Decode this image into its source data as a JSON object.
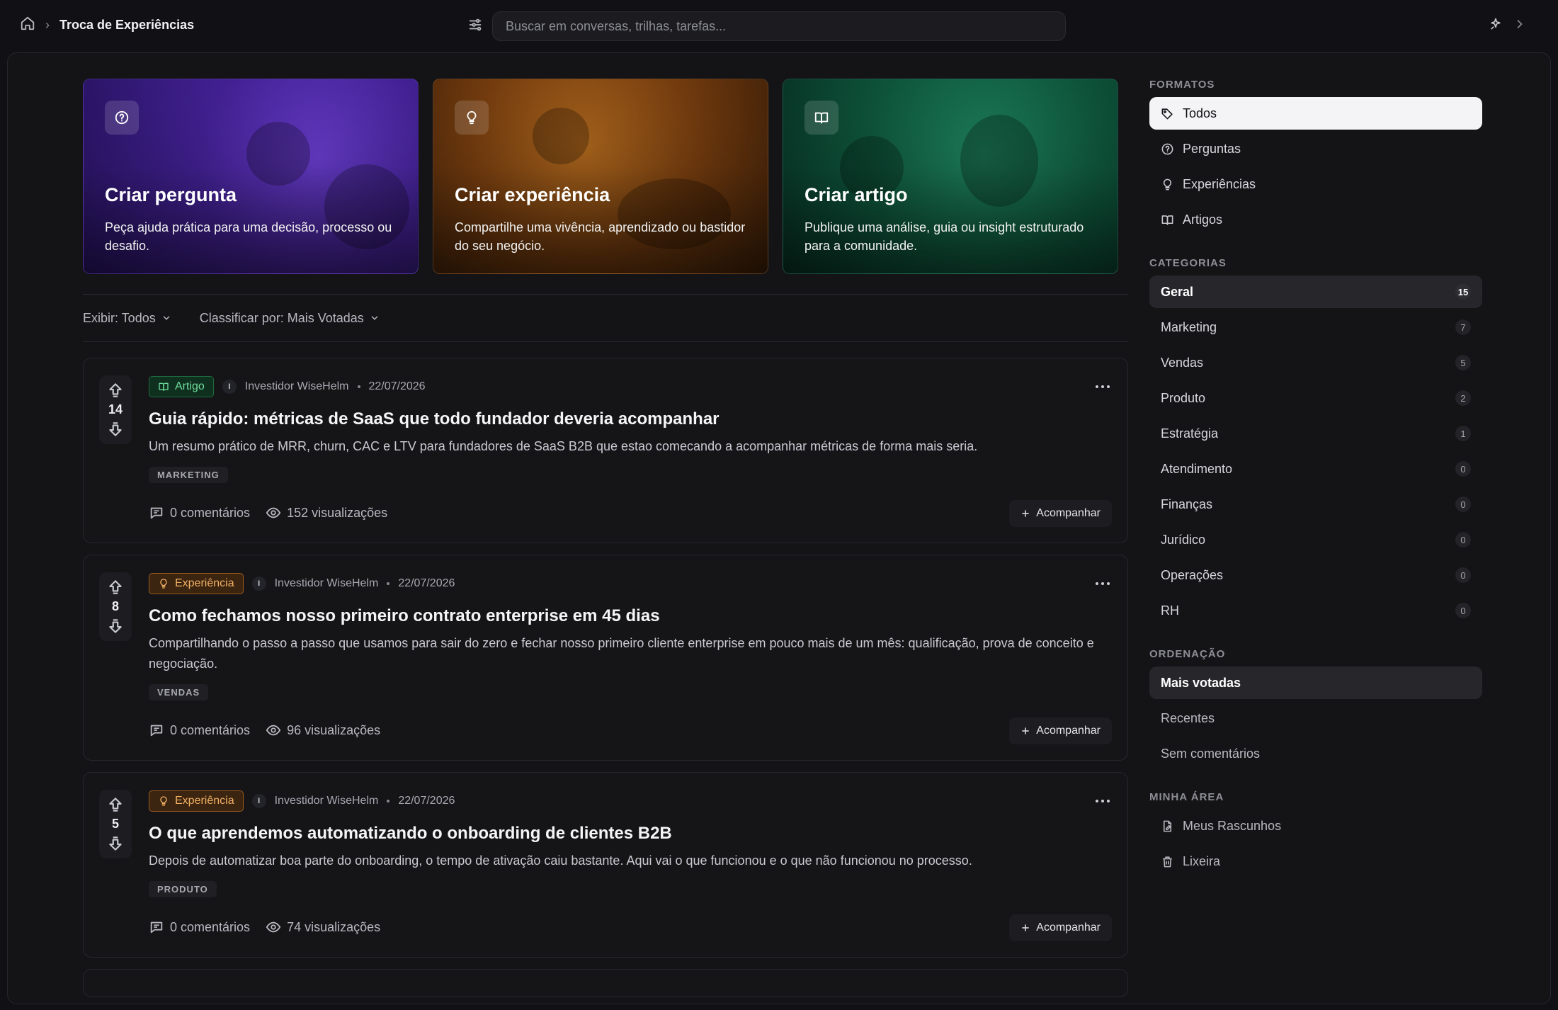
{
  "header": {
    "breadcrumb_title": "Troca de Experiências",
    "search_placeholder": "Buscar em conversas, trilhas, tarefas..."
  },
  "heroes": [
    {
      "title": "Criar pergunta",
      "desc": "Peça ajuda prática para uma decisão, processo ou desafio.",
      "icon": "question-icon",
      "color": "#5a2fc0"
    },
    {
      "title": "Criar experiência",
      "desc": "Compartilhe uma vivência, aprendizado ou bastidor do seu negócio.",
      "icon": "lightbulb-icon",
      "color": "#9a5218"
    },
    {
      "title": "Criar artigo",
      "desc": "Publique uma análise, guia ou insight estruturado para a comunidade.",
      "icon": "book-icon",
      "color": "#157550"
    }
  ],
  "controls": {
    "display": "Exibir: Todos",
    "sort": "Classificar por: Mais Votadas"
  },
  "posts": [
    {
      "votes": "14",
      "type": "Artigo",
      "avatar": "I",
      "author": "Investidor WiseHelm",
      "date": "22/07/2026",
      "title": "Guia rápido: métricas de SaaS que todo fundador deveria acompanhar",
      "desc": "Um resumo prático de MRR, churn, CAC e LTV para fundadores de SaaS B2B que estao comecando a acompanhar métricas de forma mais seria.",
      "tag": "MARKETING",
      "comments": "0 comentários",
      "views": "152 visualizações",
      "follow": "Acompanhar"
    },
    {
      "votes": "8",
      "type": "Experiência",
      "avatar": "I",
      "author": "Investidor WiseHelm",
      "date": "22/07/2026",
      "title": "Como fechamos nosso primeiro contrato enterprise em 45 dias",
      "desc": "Compartilhando o passo a passo que usamos para sair do zero e fechar nosso primeiro cliente enterprise em pouco mais de um mês: qualificação, prova de conceito e negociação.",
      "tag": "VENDAS",
      "comments": "0 comentários",
      "views": "96 visualizações",
      "follow": "Acompanhar"
    },
    {
      "votes": "5",
      "type": "Experiência",
      "avatar": "I",
      "author": "Investidor WiseHelm",
      "date": "22/07/2026",
      "title": "O que aprendemos automatizando o onboarding de clientes B2B",
      "desc": "Depois de automatizar boa parte do onboarding, o tempo de ativação caiu bastante. Aqui vai o que funcionou e o que não funcionou no processo.",
      "tag": "PRODUTO",
      "comments": "0 comentários",
      "views": "74 visualizações",
      "follow": "Acompanhar"
    }
  ],
  "sidebar": {
    "formats_title": "FORMATOS",
    "formats": [
      {
        "label": "Todos",
        "icon": "tags-icon"
      },
      {
        "label": "Perguntas",
        "icon": "question-icon"
      },
      {
        "label": "Experiências",
        "icon": "lightbulb-icon"
      },
      {
        "label": "Artigos",
        "icon": "book-icon"
      }
    ],
    "categories_title": "CATEGORIAS",
    "categories": [
      {
        "label": "Geral",
        "count": "15"
      },
      {
        "label": "Marketing",
        "count": "7"
      },
      {
        "label": "Vendas",
        "count": "5"
      },
      {
        "label": "Produto",
        "count": "2"
      },
      {
        "label": "Estratégia",
        "count": "1"
      },
      {
        "label": "Atendimento",
        "count": "0"
      },
      {
        "label": "Finanças",
        "count": "0"
      },
      {
        "label": "Jurídico",
        "count": "0"
      },
      {
        "label": "Operações",
        "count": "0"
      },
      {
        "label": "RH",
        "count": "0"
      }
    ],
    "sort_title": "ORDENAÇÃO",
    "sorts": [
      "Mais votadas",
      "Recentes",
      "Sem comentários"
    ],
    "my_title": "MINHA ÁREA",
    "my": [
      {
        "label": "Meus Rascunhos",
        "icon": "draft-icon"
      },
      {
        "label": "Lixeira",
        "icon": "trash-icon"
      }
    ]
  }
}
